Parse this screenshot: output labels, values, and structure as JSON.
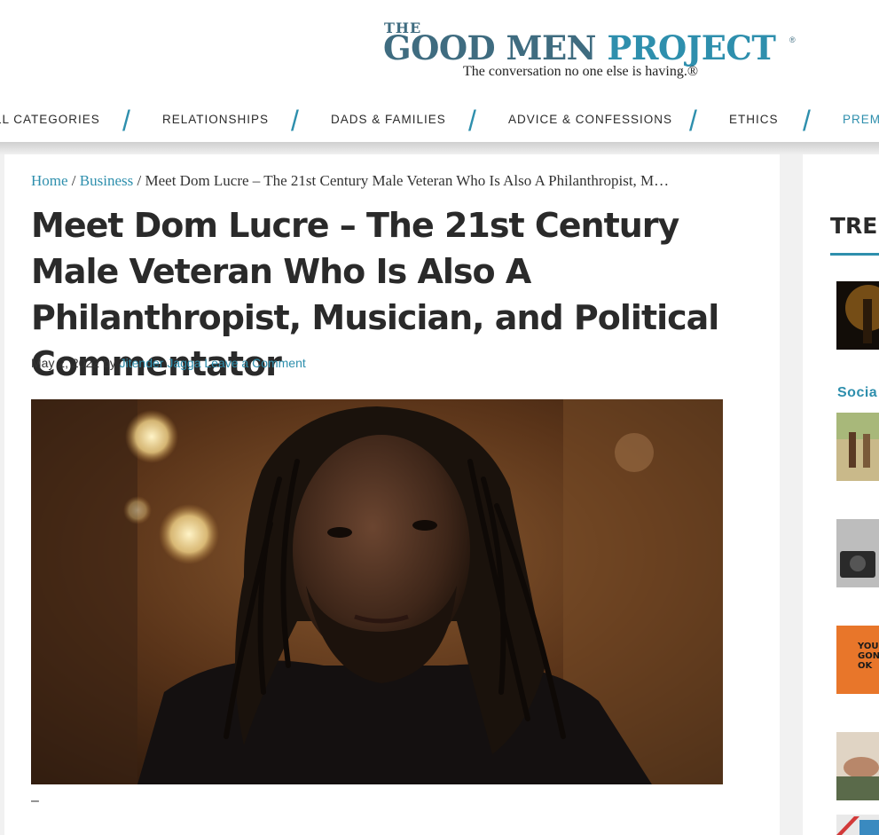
{
  "logo": {
    "top_word": "THE",
    "word_good_men": "GOOD MEN",
    "word_project": "PROJECT",
    "registered": "®",
    "tagline": "The conversation no one else is having.®"
  },
  "nav": {
    "items": [
      {
        "label": "ll Categories"
      },
      {
        "label": "Relationships"
      },
      {
        "label": "Dads & Families"
      },
      {
        "label": "Advice & Confessions"
      },
      {
        "label": "Ethics"
      },
      {
        "label": "Prem"
      }
    ],
    "separator": "/"
  },
  "breadcrumb": {
    "home": "Home",
    "sep": "/",
    "business": "Business",
    "current": "Meet Dom Lucre – The 21st Century Male Veteran Who Is Also A Philanthropist, M…"
  },
  "article": {
    "title": "Meet Dom Lucre – The 21st Century Male Veteran Who Is Also A Philanthropist, Musician, and Political Commentator",
    "date": "May 2, 2022",
    "by": "by",
    "author": "Jitender Jagga",
    "comment_link": "Leave a Comment",
    "after_image": "–"
  },
  "sidebar": {
    "heading": "TREN",
    "category": "Socia",
    "thumb_text": "YOU GONN OK"
  },
  "colors": {
    "accent": "#2e8fad",
    "logo_dark": "#3f6c80",
    "text": "#2a2a2a"
  }
}
